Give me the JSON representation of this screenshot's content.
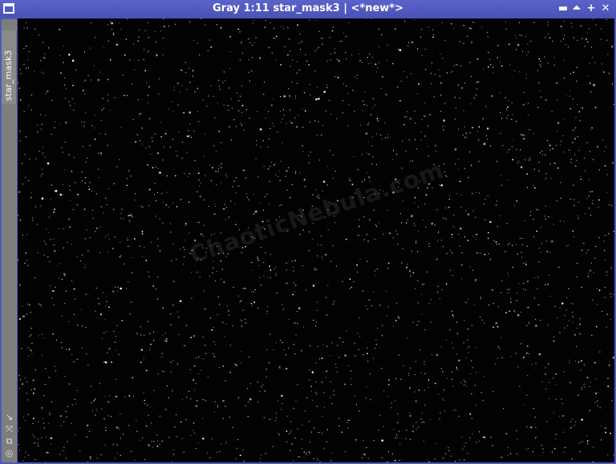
{
  "window": {
    "title": "Gray 1:11 star_mask3 | <*new*>",
    "controls": {
      "shade": "▬",
      "collapse": "⏶",
      "maximize": "+",
      "close": "✕"
    },
    "colors": {
      "titlebar": "#4f58bd",
      "canvas": "#020202",
      "sidebar": "#7d7d7d"
    }
  },
  "sidebar": {
    "view_tab_label": "star_mask3",
    "tools": [
      {
        "icon": "arrow-down-right-icon",
        "glyph": "↘"
      },
      {
        "icon": "fit-view-icon",
        "glyph": "⤧"
      },
      {
        "icon": "clone-icon",
        "glyph": "⧉"
      },
      {
        "icon": "target-icon",
        "glyph": "◎"
      }
    ]
  },
  "image": {
    "watermark": "ChaoticNebula.com"
  }
}
